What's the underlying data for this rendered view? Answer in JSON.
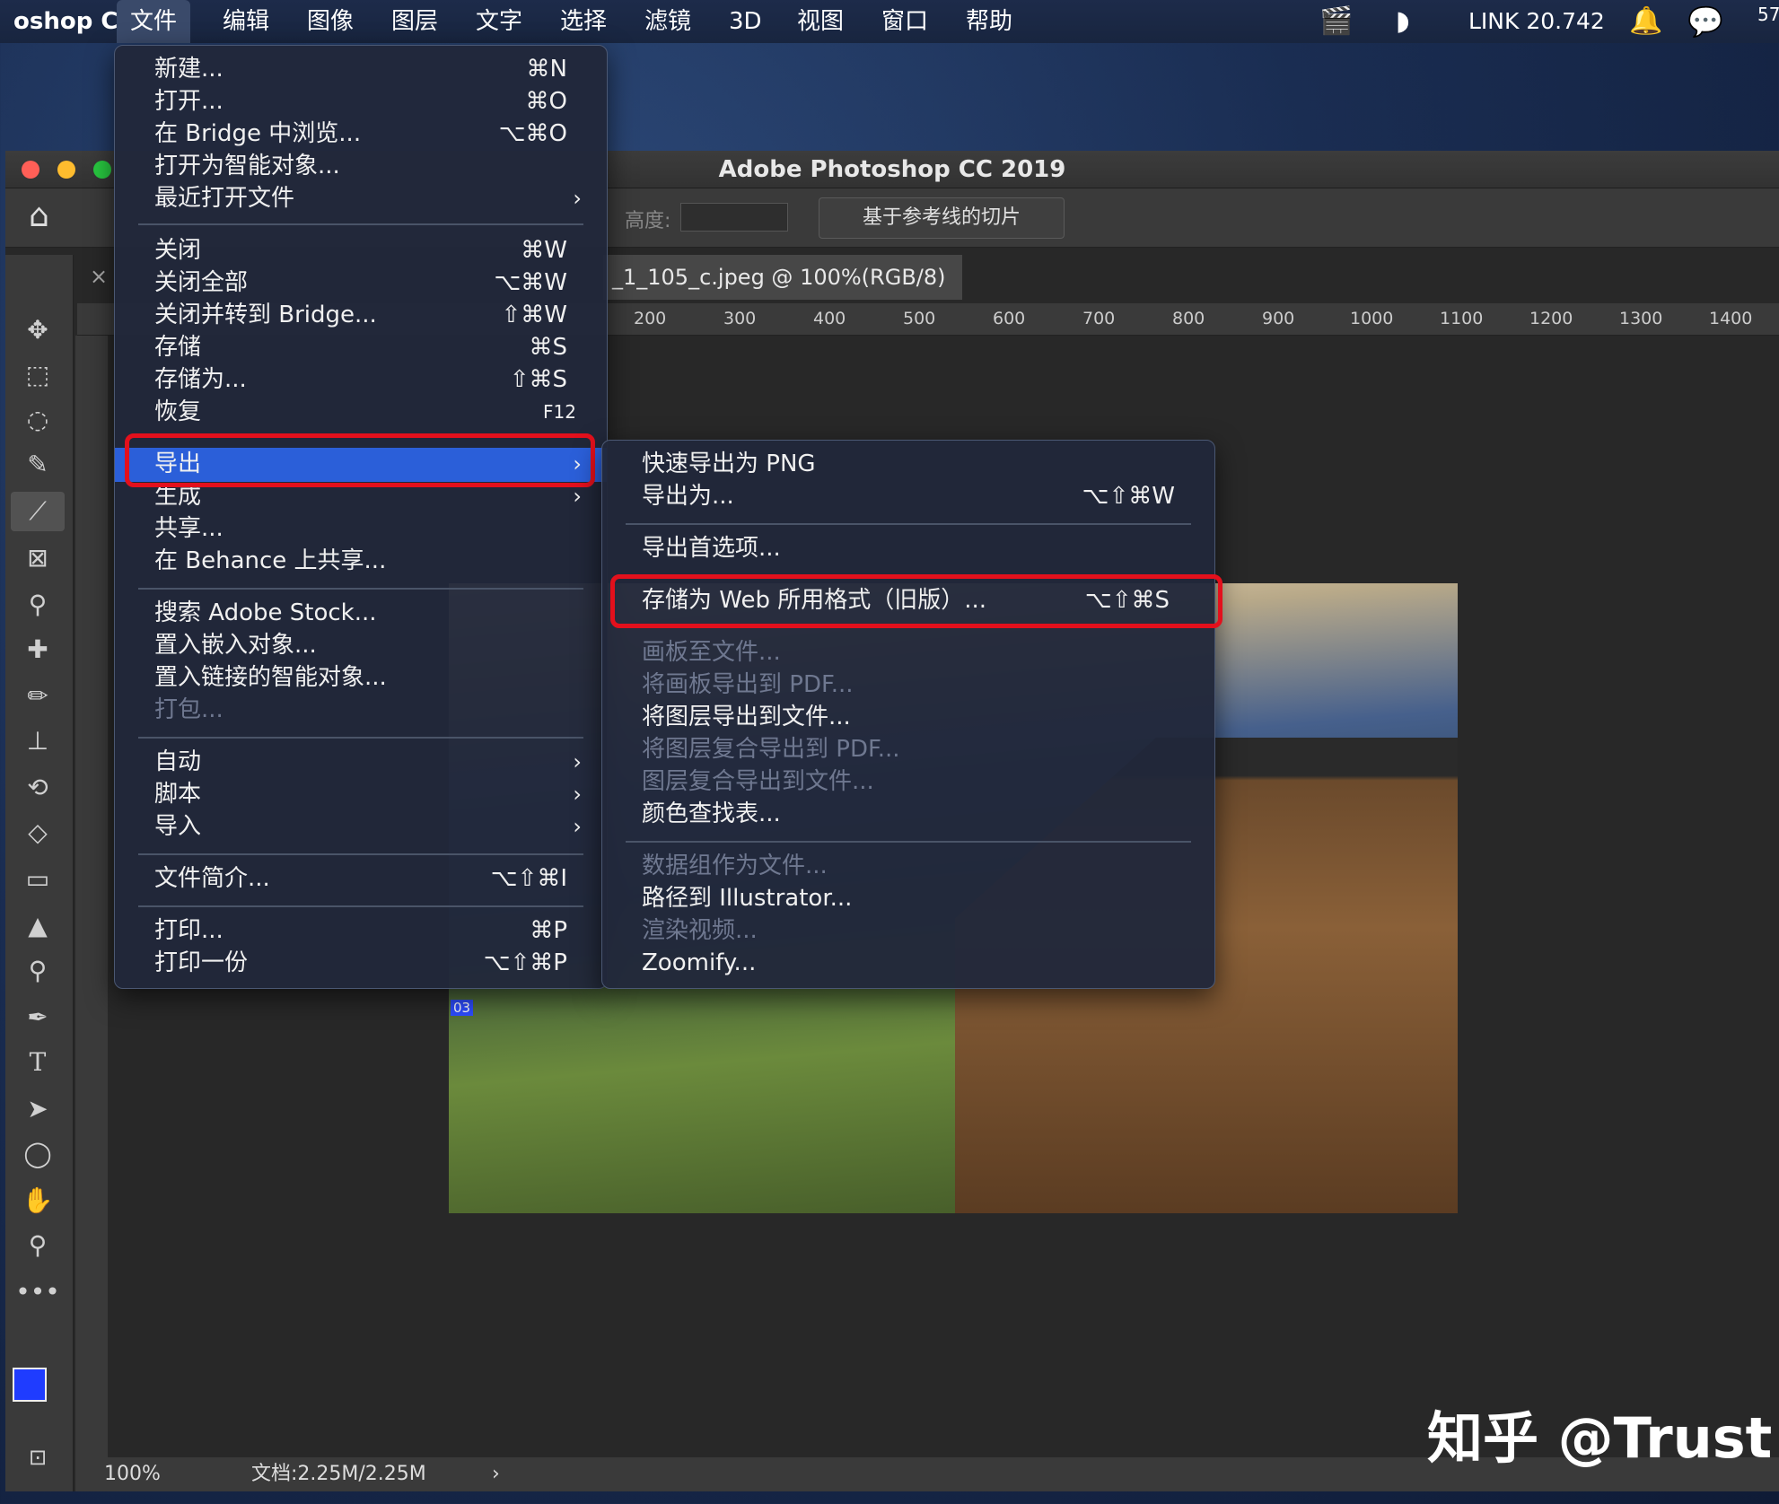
{
  "menubar": {
    "app_name": "oshop CC",
    "items": [
      "文件",
      "编辑",
      "图像",
      "图层",
      "文字",
      "选择",
      "滤镜",
      "3D",
      "视图",
      "窗口",
      "帮助"
    ],
    "link_status": "LINK 20.742",
    "clock_fragment": "57"
  },
  "window": {
    "title": "Adobe Photoshop CC 2019",
    "options": {
      "height_label": "高度:",
      "slice_button": "基于参考线的切片"
    },
    "doc_tab": "_1_105_c.jpeg @ 100%(RGB/8) *",
    "ruler_ticks": [
      "200",
      "300",
      "400",
      "500",
      "600",
      "700",
      "800",
      "900",
      "1000",
      "1100",
      "1200",
      "1300",
      "1400"
    ],
    "slice_label": "03",
    "status": {
      "zoom": "100%",
      "doc_info": "文档:2.25M/2.25M"
    }
  },
  "file_menu": [
    {
      "label": "新建...",
      "shortcut": "⌘N"
    },
    {
      "label": "打开...",
      "shortcut": "⌘O"
    },
    {
      "label": "在 Bridge 中浏览...",
      "shortcut": "⌥⌘O"
    },
    {
      "label": "打开为智能对象...",
      "shortcut": ""
    },
    {
      "label": "最近打开文件",
      "shortcut": "",
      "submenu": true
    },
    {
      "label": "关闭",
      "shortcut": "⌘W"
    },
    {
      "label": "关闭全部",
      "shortcut": "⌥⌘W"
    },
    {
      "label": "关闭并转到 Bridge...",
      "shortcut": "⇧⌘W"
    },
    {
      "label": "存储",
      "shortcut": "⌘S"
    },
    {
      "label": "存储为...",
      "shortcut": "⇧⌘S"
    },
    {
      "label": "恢复",
      "shortcut": "F12"
    },
    {
      "label": "导出",
      "shortcut": "",
      "submenu": true,
      "highlighted": true
    },
    {
      "label": "生成",
      "shortcut": "",
      "submenu": true
    },
    {
      "label": "共享...",
      "shortcut": ""
    },
    {
      "label": "在 Behance 上共享...",
      "shortcut": ""
    },
    {
      "label": "搜索 Adobe Stock...",
      "shortcut": ""
    },
    {
      "label": "置入嵌入对象...",
      "shortcut": ""
    },
    {
      "label": "置入链接的智能对象...",
      "shortcut": ""
    },
    {
      "label": "打包...",
      "shortcut": "",
      "disabled": true
    },
    {
      "label": "自动",
      "shortcut": "",
      "submenu": true
    },
    {
      "label": "脚本",
      "shortcut": "",
      "submenu": true
    },
    {
      "label": "导入",
      "shortcut": "",
      "submenu": true
    },
    {
      "label": "文件简介...",
      "shortcut": "⌥⇧⌘I"
    },
    {
      "label": "打印...",
      "shortcut": "⌘P"
    },
    {
      "label": "打印一份",
      "shortcut": "⌥⇧⌘P"
    }
  ],
  "export_menu": [
    {
      "label": "快速导出为 PNG",
      "shortcut": ""
    },
    {
      "label": "导出为...",
      "shortcut": "⌥⇧⌘W"
    },
    {
      "label": "导出首选项...",
      "shortcut": ""
    },
    {
      "label": "存储为 Web 所用格式（旧版）...",
      "shortcut": "⌥⇧⌘S",
      "boxed": true
    },
    {
      "label": "画板至文件...",
      "shortcut": "",
      "disabled": true
    },
    {
      "label": "将画板导出到 PDF...",
      "shortcut": "",
      "disabled": true
    },
    {
      "label": "将图层导出到文件...",
      "shortcut": ""
    },
    {
      "label": "将图层复合导出到 PDF...",
      "shortcut": "",
      "disabled": true
    },
    {
      "label": "图层复合导出到文件...",
      "shortcut": "",
      "disabled": true
    },
    {
      "label": "颜色查找表...",
      "shortcut": ""
    },
    {
      "label": "数据组作为文件...",
      "shortcut": "",
      "disabled": true
    },
    {
      "label": "路径到 Illustrator...",
      "shortcut": ""
    },
    {
      "label": "渲染视频...",
      "shortcut": "",
      "disabled": true
    },
    {
      "label": "Zoomify...",
      "shortcut": ""
    }
  ],
  "watermark": "知乎 @Trust",
  "colors": {
    "highlight": "#2b5fd9",
    "red_box": "#e3101c",
    "foreground": "#1f3cff"
  }
}
